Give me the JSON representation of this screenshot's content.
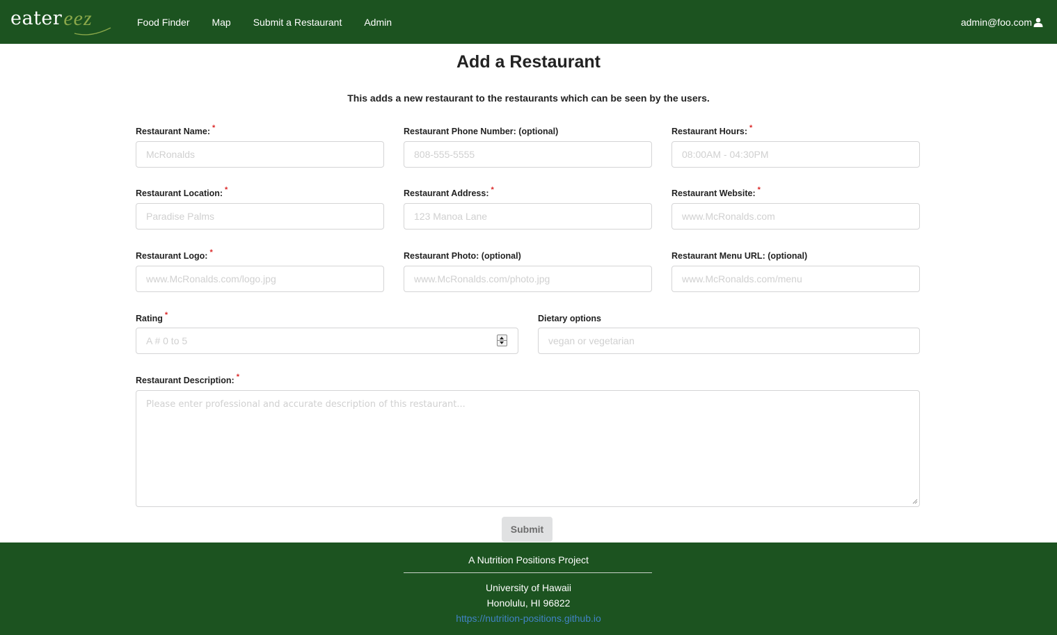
{
  "navbar": {
    "logo": {
      "part1": "eater",
      "part2": "eez"
    },
    "links": [
      "Food Finder",
      "Map",
      "Submit a Restaurant",
      "Admin"
    ],
    "user": "admin@foo.com"
  },
  "page": {
    "title": "Add a Restaurant",
    "subtitle": "This adds a new restaurant to the restaurants which can be seen by the users."
  },
  "form": {
    "name": {
      "label": "Restaurant Name:",
      "required": "*",
      "placeholder": "McRonalds",
      "value": ""
    },
    "phone": {
      "label": "Restaurant Phone Number: (optional)",
      "placeholder": "808-555-5555",
      "value": ""
    },
    "hours": {
      "label": "Restaurant Hours:",
      "required": "*",
      "placeholder": "08:00AM - 04:30PM",
      "value": ""
    },
    "location": {
      "label": "Restaurant Location:",
      "required": "*",
      "placeholder": "Paradise Palms",
      "value": ""
    },
    "address": {
      "label": "Restaurant Address:",
      "required": "*",
      "placeholder": "123 Manoa Lane",
      "value": ""
    },
    "website": {
      "label": "Restaurant Website:",
      "required": "*",
      "placeholder": "www.McRonalds.com",
      "value": ""
    },
    "logo": {
      "label": "Restaurant Logo:",
      "required": "*",
      "placeholder": "www.McRonalds.com/logo.jpg",
      "value": ""
    },
    "photo": {
      "label": "Restaurant Photo: (optional)",
      "placeholder": "www.McRonalds.com/photo.jpg",
      "value": ""
    },
    "menu": {
      "label": "Restaurant Menu URL: (optional)",
      "placeholder": "www.McRonalds.com/menu",
      "value": ""
    },
    "rating": {
      "label": "Rating",
      "required": "*",
      "placeholder": "A # 0 to 5",
      "value": ""
    },
    "dietary": {
      "label": "Dietary options",
      "placeholder": "vegan or vegetarian",
      "value": ""
    },
    "description": {
      "label": "Restaurant Description:",
      "required": "*",
      "placeholder": "Please enter professional and accurate description of this restaurant...",
      "value": ""
    },
    "submit_label": "Submit"
  },
  "footer": {
    "heading": "A Nutrition Positions Project",
    "line1": "University of Hawaii",
    "line2": "Honolulu, HI 96822",
    "link": "https://nutrition-positions.github.io"
  },
  "colors": {
    "navbar_bg": "#1c5320",
    "logo_accent": "#8aa84a",
    "required_mark": "#db2828",
    "link": "#4183c4",
    "submit_bg": "#e0e1e2"
  }
}
